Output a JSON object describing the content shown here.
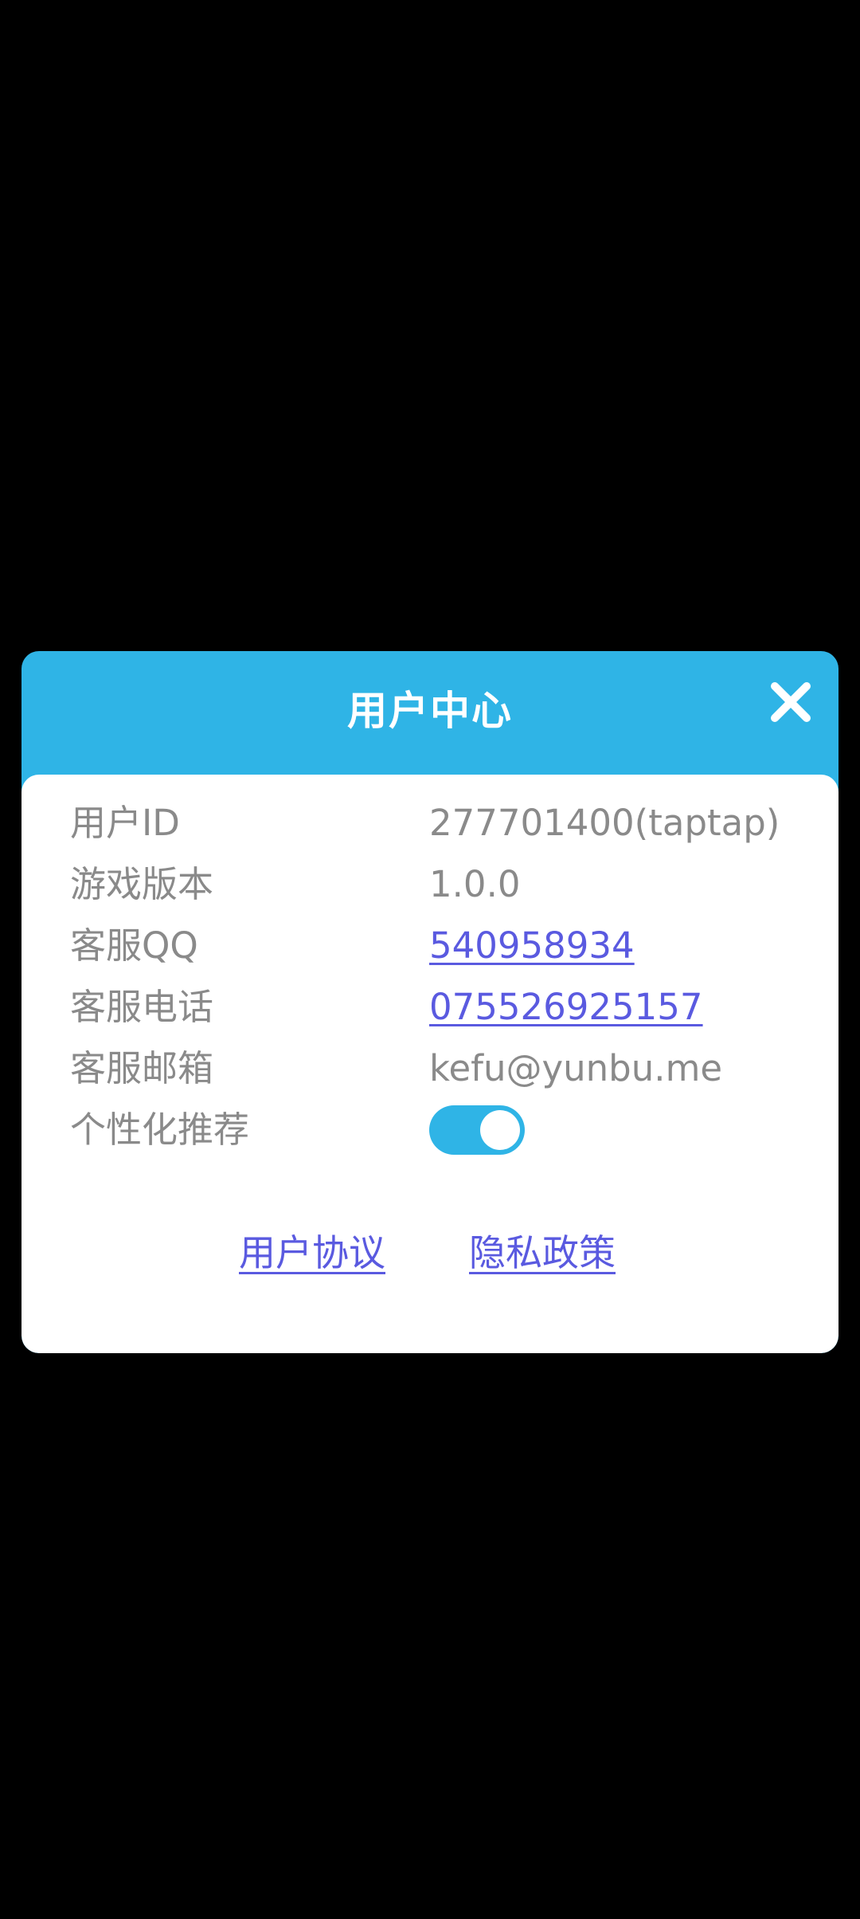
{
  "dialog": {
    "title": "用户中心",
    "close_icon": "close-icon"
  },
  "info": {
    "rows": [
      {
        "label": "用户ID",
        "value": "277701400(taptap)"
      },
      {
        "label": "游戏版本",
        "value": "1.0.0"
      },
      {
        "label": "客服QQ",
        "value": "540958934"
      },
      {
        "label": "客服电话",
        "value": "075526925157"
      },
      {
        "label": "客服邮箱",
        "value": "kefu@yunbu.me"
      },
      {
        "label": "个性化推荐",
        "toggle_on": true
      }
    ]
  },
  "footer": {
    "user_agreement": "用户协议",
    "privacy_policy": "隐私政策"
  },
  "colors": {
    "header": "#2fb4e6",
    "link": "#5a5ae0",
    "text": "#8a8a8a",
    "background": "#000000"
  }
}
